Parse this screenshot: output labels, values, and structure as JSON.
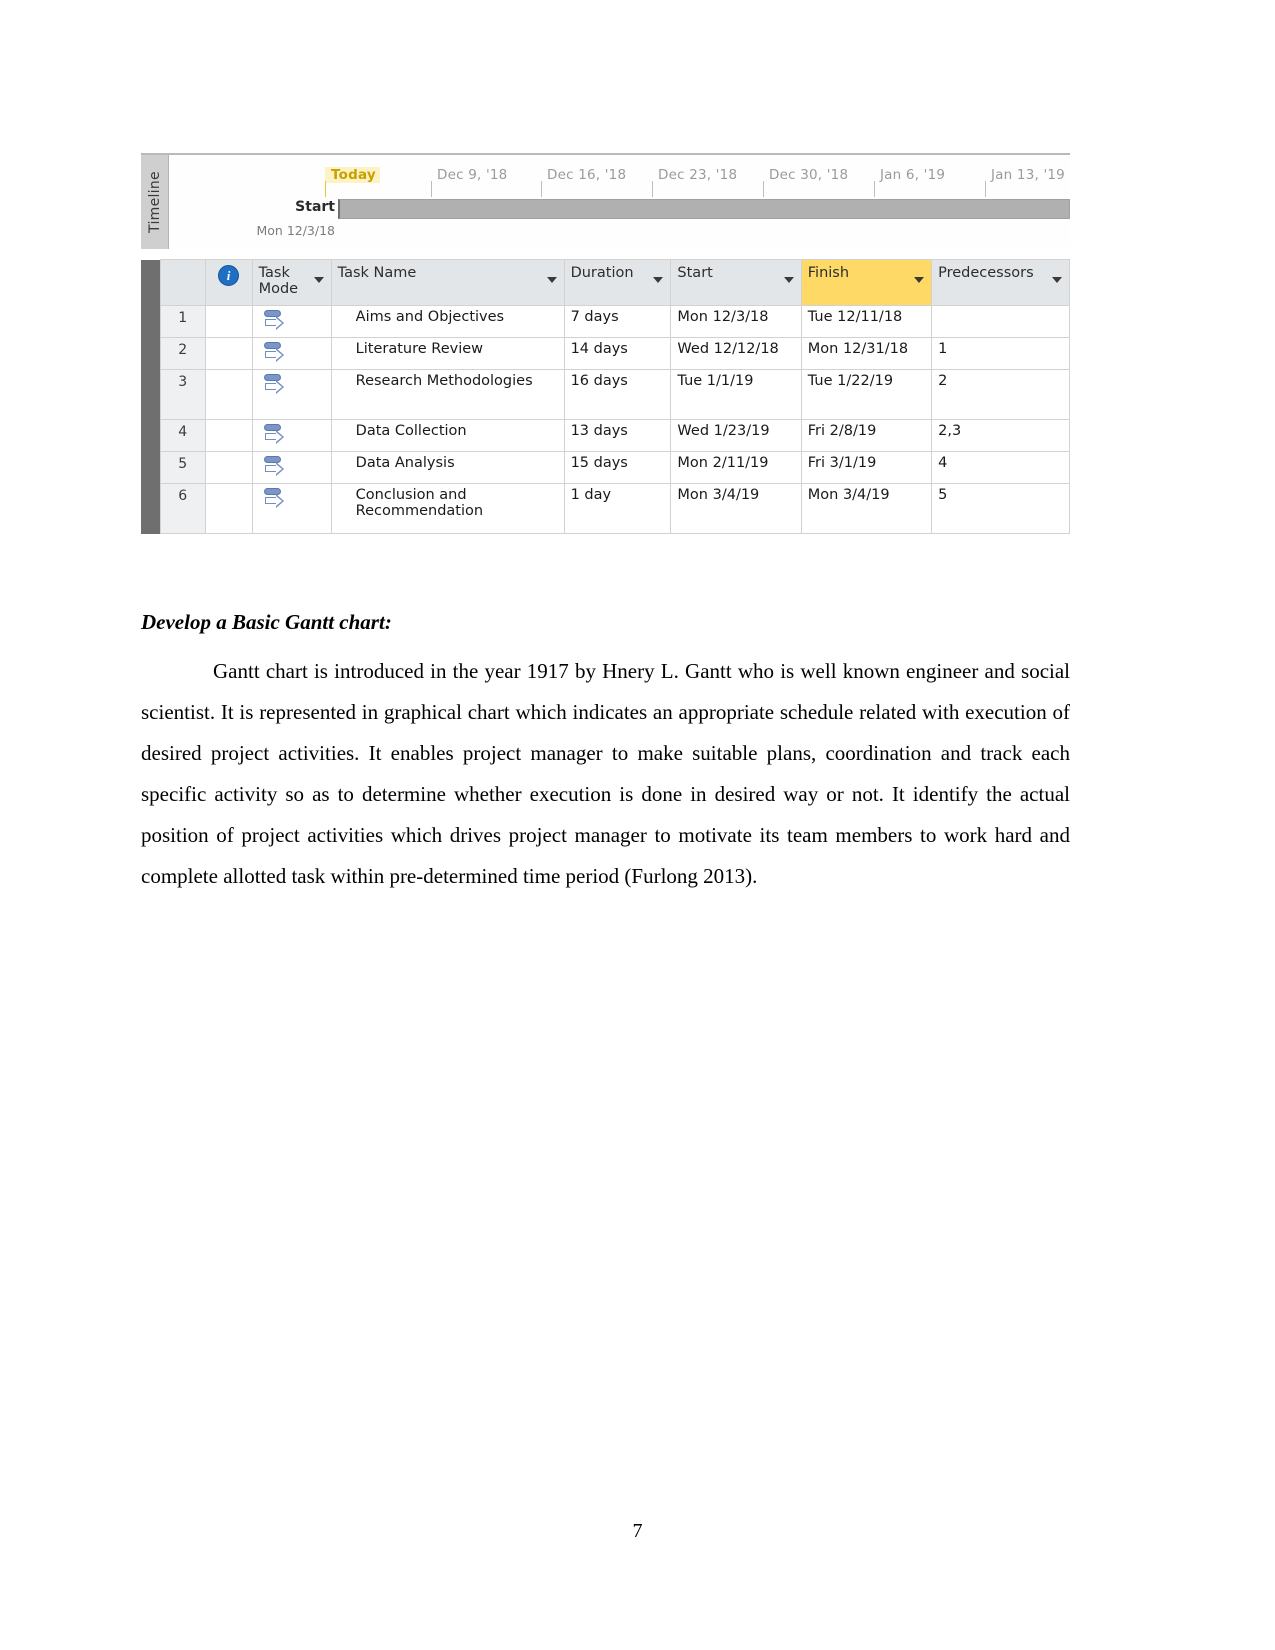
{
  "project_screenshot": {
    "timeline": {
      "panel_label": "Timeline",
      "today_label": "Today",
      "start_label": "Start",
      "start_date": "Mon 12/3/18",
      "ticks": [
        {
          "label": "Dec 9, '18"
        },
        {
          "label": "Dec 16, '18"
        },
        {
          "label": "Dec 23, '18"
        },
        {
          "label": "Dec 30, '18"
        },
        {
          "label": "Jan 6, '19"
        },
        {
          "label": "Jan 13, '19"
        }
      ]
    },
    "grid": {
      "columns": [
        {
          "key": "id",
          "label": ""
        },
        {
          "key": "indicator",
          "label": "",
          "icon": "info-icon"
        },
        {
          "key": "task_mode",
          "label": "Task Mode"
        },
        {
          "key": "task_name",
          "label": "Task Name"
        },
        {
          "key": "duration",
          "label": "Duration"
        },
        {
          "key": "start",
          "label": "Start"
        },
        {
          "key": "finish",
          "label": "Finish",
          "highlight": true
        },
        {
          "key": "predecessors",
          "label": "Predecessors"
        }
      ],
      "rows": [
        {
          "id": "1",
          "task_mode": "auto-scheduled-icon",
          "task_name": "Aims and Objectives",
          "duration": "7 days",
          "start": "Mon 12/3/18",
          "finish": "Tue 12/11/18",
          "predecessors": ""
        },
        {
          "id": "2",
          "task_mode": "auto-scheduled-icon",
          "task_name": "Literature Review",
          "duration": "14 days",
          "start": "Wed 12/12/18",
          "finish": "Mon 12/31/18",
          "predecessors": "1"
        },
        {
          "id": "3",
          "task_mode": "auto-scheduled-icon",
          "task_name": "Research Methodologies",
          "duration": "16 days",
          "start": "Tue 1/1/19",
          "finish": "Tue 1/22/19",
          "predecessors": "2"
        },
        {
          "id": "4",
          "task_mode": "auto-scheduled-icon",
          "task_name": "Data Collection",
          "duration": "13 days",
          "start": "Wed 1/23/19",
          "finish": "Fri 2/8/19",
          "predecessors": "2,3"
        },
        {
          "id": "5",
          "task_mode": "auto-scheduled-icon",
          "task_name": "Data Analysis",
          "duration": "15 days",
          "start": "Mon 2/11/19",
          "finish": "Fri 3/1/19",
          "predecessors": "4"
        },
        {
          "id": "6",
          "task_mode": "auto-scheduled-icon",
          "task_name": "Conclusion and Recommendation",
          "duration": "1 day",
          "start": "Mon 3/4/19",
          "finish": "Mon 3/4/19",
          "predecessors": "5"
        }
      ]
    },
    "colors": {
      "finish_highlight": "#ffd966",
      "header_background": "#e3e6e9",
      "gutter": "#6f6f6f",
      "today_text": "#c8a000",
      "timeline_bar": "#b0b0b0"
    }
  },
  "document": {
    "heading": "Develop a Basic Gantt chart:",
    "paragraph": "Gantt chart is introduced in the year 1917 by Hnery L. Gantt who is well known engineer and social scientist. It is represented in graphical chart which indicates an appropriate schedule related with execution of desired project activities. It enables project manager to make suitable plans, coordination and track each specific activity so as to determine whether execution is done in desired way or not. It identify the actual position of project activities which drives project manager to motivate its team members to work hard and complete allotted task within pre-determined time period (Furlong 2013).",
    "page_number": "7"
  }
}
